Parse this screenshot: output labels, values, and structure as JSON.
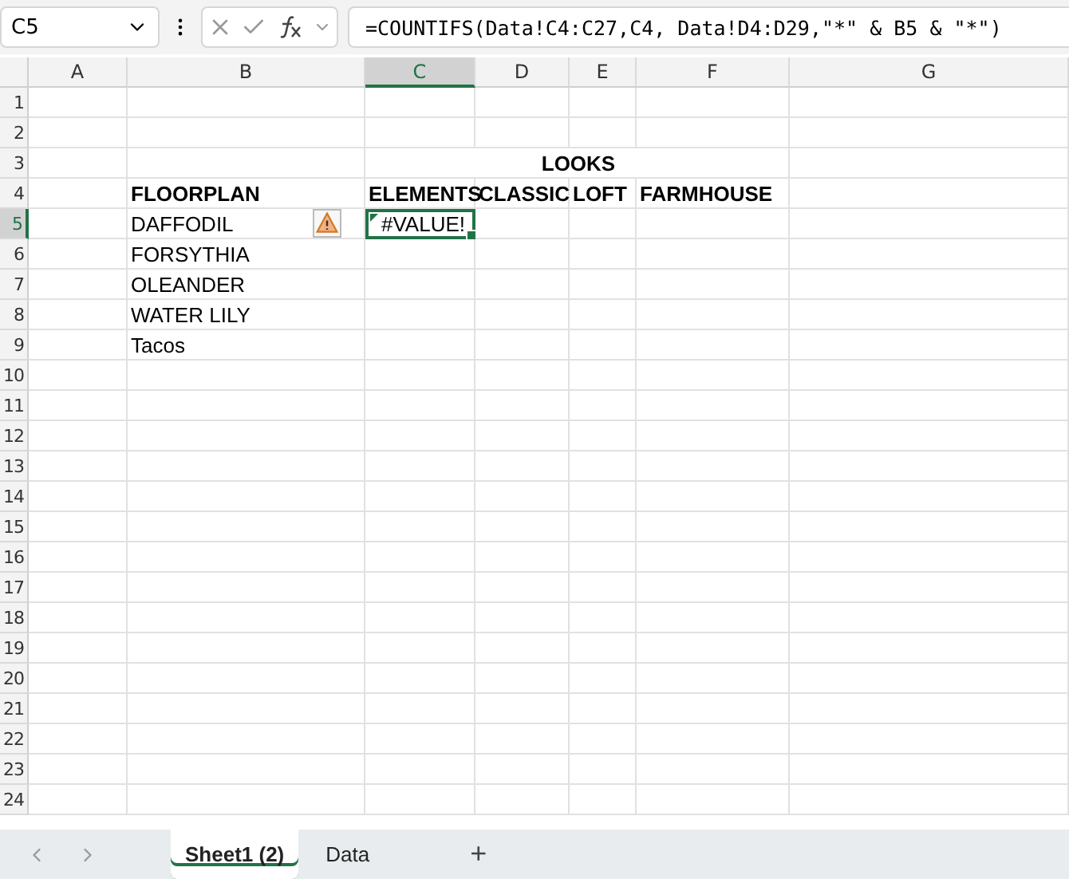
{
  "formula_bar": {
    "name_box": "C5",
    "formula": "=COUNTIFS(Data!C4:C27,C4, Data!D4:D29,\"*\" & B5 & \"*\")"
  },
  "columns": [
    {
      "label": "A",
      "selected": false
    },
    {
      "label": "B",
      "selected": false
    },
    {
      "label": "C",
      "selected": true
    },
    {
      "label": "D",
      "selected": false
    },
    {
      "label": "E",
      "selected": false
    },
    {
      "label": "F",
      "selected": false
    },
    {
      "label": "G",
      "selected": false
    }
  ],
  "rows": [
    {
      "number": "1",
      "selected": false
    },
    {
      "number": "2",
      "selected": false
    },
    {
      "number": "3",
      "selected": false,
      "bold": true,
      "cells": {
        "C:F": "LOOKS"
      }
    },
    {
      "number": "4",
      "selected": false,
      "bold": true,
      "cells": {
        "B": "FLOORPLAN",
        "C": "ELEMENTS",
        "D": "CLASSIC",
        "E": "LOFT",
        "F": "FARMHOUSE"
      }
    },
    {
      "number": "5",
      "selected": true,
      "error": true,
      "cells": {
        "B": "DAFFODIL",
        "C": "#VALUE!"
      }
    },
    {
      "number": "6",
      "selected": false,
      "cells": {
        "B": "FORSYTHIA"
      }
    },
    {
      "number": "7",
      "selected": false,
      "cells": {
        "B": "OLEANDER"
      }
    },
    {
      "number": "8",
      "selected": false,
      "cells": {
        "B": "WATER LILY"
      }
    },
    {
      "number": "9",
      "selected": false,
      "cells": {
        "B": "Tacos"
      }
    },
    {
      "number": "10",
      "selected": false
    },
    {
      "number": "11",
      "selected": false
    },
    {
      "number": "12",
      "selected": false
    },
    {
      "number": "13",
      "selected": false
    },
    {
      "number": "14",
      "selected": false
    },
    {
      "number": "15",
      "selected": false
    },
    {
      "number": "16",
      "selected": false
    },
    {
      "number": "17",
      "selected": false
    },
    {
      "number": "18",
      "selected": false
    },
    {
      "number": "19",
      "selected": false
    },
    {
      "number": "20",
      "selected": false
    },
    {
      "number": "21",
      "selected": false
    },
    {
      "number": "22",
      "selected": false
    },
    {
      "number": "23",
      "selected": false
    },
    {
      "number": "24",
      "selected": false
    }
  ],
  "sheet_tabs": [
    {
      "label": "Sheet1 (2)",
      "selected": true
    },
    {
      "label": "Data",
      "selected": false
    }
  ],
  "add_sheet": "+"
}
